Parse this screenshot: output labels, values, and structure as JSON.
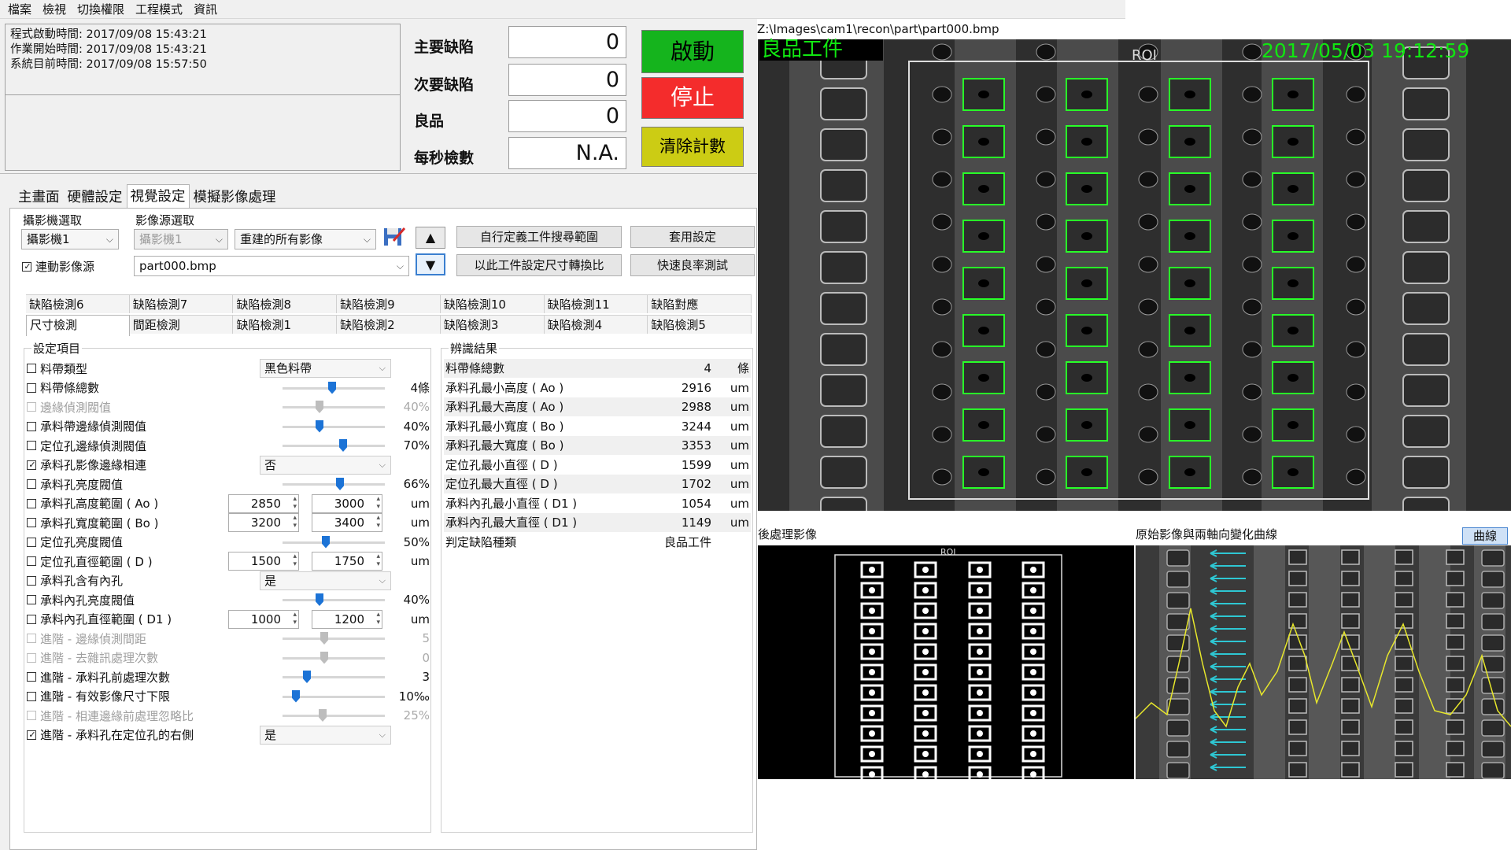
{
  "menu": [
    "檔案",
    "檢視",
    "切換權限",
    "工程模式",
    "資訊"
  ],
  "times": {
    "program_start": "程式啟動時間: 2017/09/08 15:43:21",
    "work_start": "作業開始時間: 2017/09/08 15:43:21",
    "system_now": "系統目前時間: 2017/09/08 15:57:50"
  },
  "counters": [
    {
      "label": "主要缺陷",
      "value": "0"
    },
    {
      "label": "次要缺陷",
      "value": "0"
    },
    {
      "label": "良品",
      "value": "0"
    },
    {
      "label": "每秒檢數",
      "value": "N.A."
    }
  ],
  "buttons": {
    "start": "啟動",
    "stop": "停止",
    "clear": "清除計數"
  },
  "main_tabs": [
    "主畫面",
    "硬體設定",
    "視覺設定",
    "模擬影像處理"
  ],
  "camera": {
    "group_label": "攝影機選取",
    "selected": "攝影機1",
    "link_label": "連動影像源"
  },
  "source": {
    "group_label": "影像源選取",
    "camera": "攝影機1",
    "mode": "重建的所有影像",
    "file": "part000.bmp"
  },
  "action_buttons": {
    "custom_range": "自行定義工件搜尋範圍",
    "apply": "套用設定",
    "convert_ratio": "以此工件設定尺寸轉換比",
    "quick_test": "快速良率測試"
  },
  "sub_tabs_row1": [
    "缺陷檢測6",
    "缺陷檢測7",
    "缺陷檢測8",
    "缺陷檢測9",
    "缺陷檢測10",
    "缺陷檢測11",
    "缺陷對應"
  ],
  "sub_tabs_row2": [
    "尺寸檢測",
    "間距檢測",
    "缺陷檢測1",
    "缺陷檢測2",
    "缺陷檢測3",
    "缺陷檢測4",
    "缺陷檢測5"
  ],
  "settings_title": "設定項目",
  "settings": [
    {
      "label": "料帶類型",
      "type": "combo",
      "value": "黑色料帶"
    },
    {
      "label": "料帶條總數",
      "type": "slider",
      "pos": 0.48,
      "value": "4條"
    },
    {
      "label": "邊緣偵測閥值",
      "type": "slider",
      "pos": 0.35,
      "value": "40%",
      "disabled": true
    },
    {
      "label": "承料帶邊緣偵測閥值",
      "type": "slider",
      "pos": 0.35,
      "value": "40%"
    },
    {
      "label": "定位孔邊緣偵測閥值",
      "type": "slider",
      "pos": 0.6,
      "value": "70%"
    },
    {
      "label": "承料孔影像邊緣相連",
      "type": "combo",
      "value": "否",
      "checked": true
    },
    {
      "label": "承料孔亮度閥值",
      "type": "slider",
      "pos": 0.57,
      "value": "66%"
    },
    {
      "label": "承料孔高度範圍 ( Ao )",
      "type": "range",
      "min": "2850",
      "max": "3000",
      "unit": "um"
    },
    {
      "label": "承料孔寬度範圍 ( Bo )",
      "type": "range",
      "min": "3200",
      "max": "3400",
      "unit": "um"
    },
    {
      "label": "定位孔亮度閥值",
      "type": "slider",
      "pos": 0.42,
      "value": "50%"
    },
    {
      "label": "定位孔直徑範圍 ( D )",
      "type": "range",
      "min": "1500",
      "max": "1750",
      "unit": "um"
    },
    {
      "label": "承料孔含有內孔",
      "type": "combo",
      "value": "是"
    },
    {
      "label": "承料內孔亮度閥值",
      "type": "slider",
      "pos": 0.35,
      "value": "40%"
    },
    {
      "label": "承料內孔直徑範圍 ( D1 )",
      "type": "range",
      "min": "1000",
      "max": "1200",
      "unit": "um"
    },
    {
      "label": "進階 - 邊緣偵測間距",
      "type": "slider",
      "pos": 0.4,
      "value": "5",
      "disabled": true
    },
    {
      "label": "進階 - 去雜訊處理次數",
      "type": "slider",
      "pos": 0.4,
      "value": "0",
      "disabled": true
    },
    {
      "label": "進階 - 承料孔前處理次數",
      "type": "slider",
      "pos": 0.22,
      "value": "3"
    },
    {
      "label": "進階 - 有效影像尺寸下限",
      "type": "slider",
      "pos": 0.1,
      "value": "10‰"
    },
    {
      "label": "進階 - 相連邊緣前處理忽略比",
      "type": "slider",
      "pos": 0.38,
      "value": "25%",
      "disabled": true
    },
    {
      "label": "進階 - 承料孔在定位孔的右側",
      "type": "combo",
      "value": "是",
      "checked": true
    }
  ],
  "results_title": "辨識結果",
  "results": [
    {
      "label": "料帶條總數",
      "value": "4",
      "unit": "條"
    },
    {
      "label": "承料孔最小高度 ( Ao )",
      "value": "2916",
      "unit": "um"
    },
    {
      "label": "承料孔最大高度 ( Ao )",
      "value": "2988",
      "unit": "um"
    },
    {
      "label": "承料孔最小寬度 ( Bo )",
      "value": "3244",
      "unit": "um"
    },
    {
      "label": "承料孔最大寬度 ( Bo )",
      "value": "3353",
      "unit": "um"
    },
    {
      "label": "定位孔最小直徑 ( D )",
      "value": "1599",
      "unit": "um"
    },
    {
      "label": "定位孔最大直徑 ( D )",
      "value": "1702",
      "unit": "um"
    },
    {
      "label": "承料內孔最小直徑 ( D1 )",
      "value": "1054",
      "unit": "um"
    },
    {
      "label": "承料內孔最大直徑 ( D1 )",
      "value": "1149",
      "unit": "um"
    },
    {
      "label": "判定缺陷種類",
      "value": "良品工件",
      "unit": ""
    }
  ],
  "image": {
    "path": "Z:\\Images\\cam1\\recon\\part\\part000.bmp",
    "status": "良品工件",
    "timestamp": "2017/05/03 19:12:59",
    "roi": "ROI",
    "post_label": "後處理影像",
    "orig_label": "原始影像與兩軸向變化曲線",
    "curve_button": "曲線"
  }
}
